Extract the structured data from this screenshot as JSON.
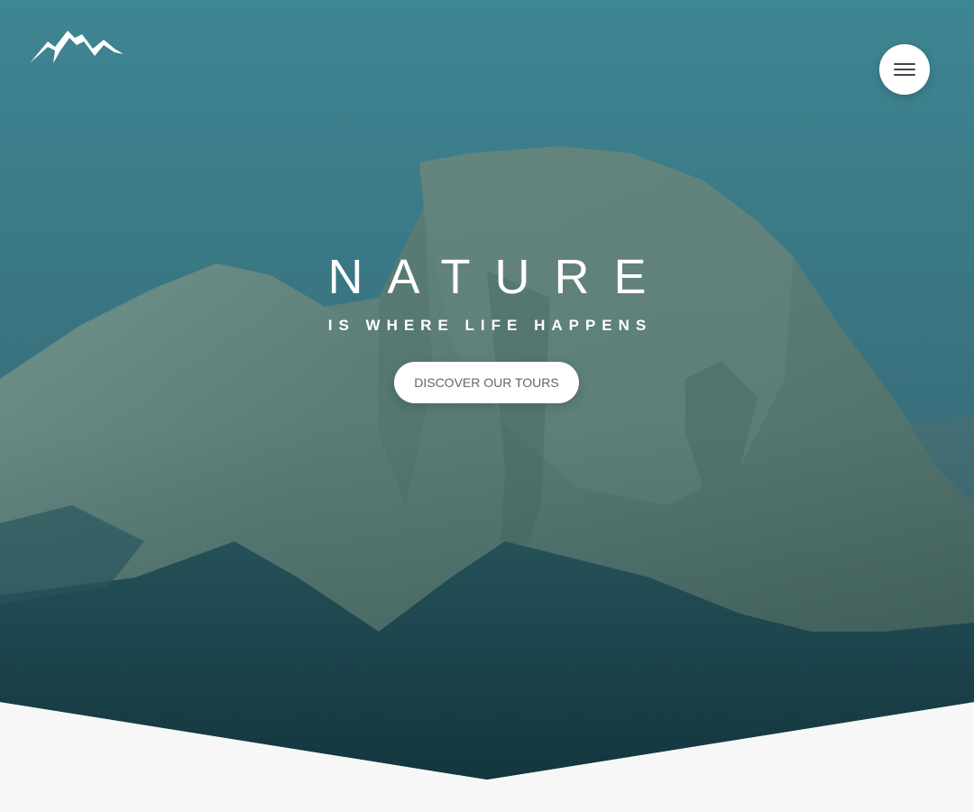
{
  "header": {
    "logo_icon": "mountain-logo-icon",
    "menu_icon": "hamburger-menu-icon"
  },
  "hero": {
    "title": "NATURE",
    "subtitle": "IS WHERE LIFE HAPPENS",
    "cta_label": "DISCOVER OUR TOURS",
    "background": "mountain-photo",
    "overlay_color": "#2f6e7b"
  },
  "colors": {
    "page_background": "#f7f7f7",
    "button_background": "#ffffff",
    "button_text": "#666666",
    "hero_text": "#ffffff"
  }
}
